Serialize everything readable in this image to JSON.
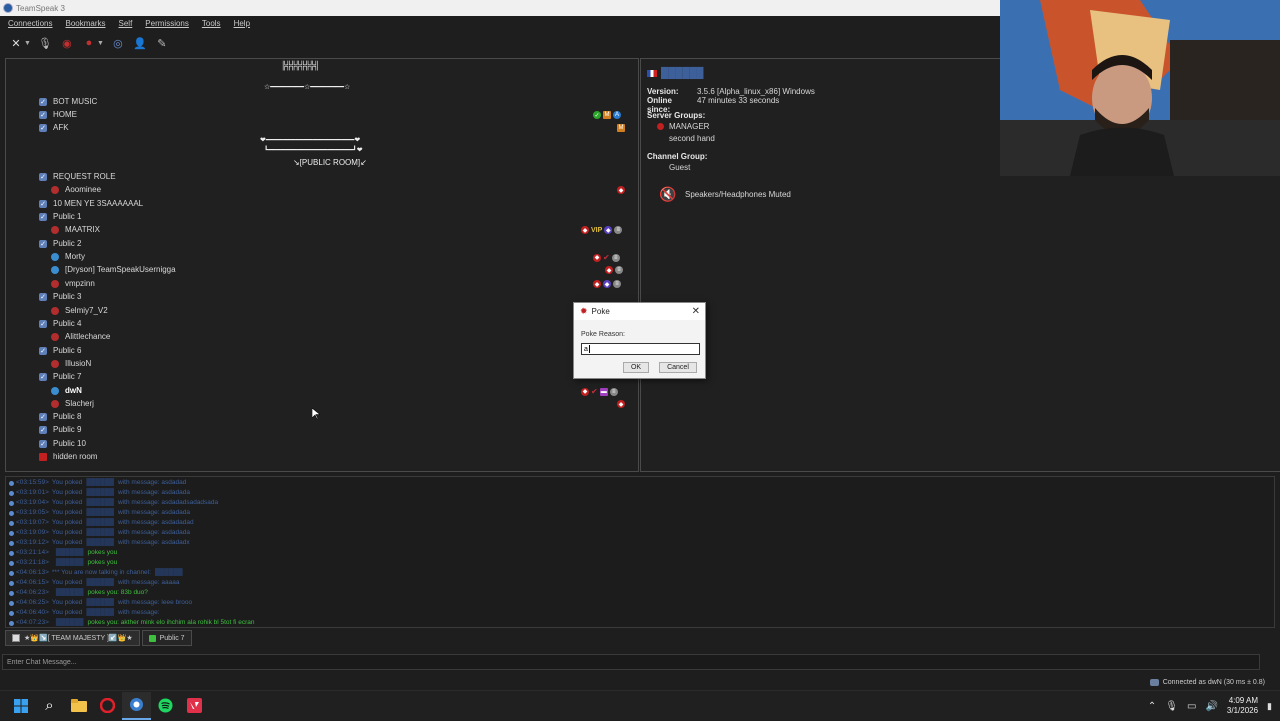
{
  "window": {
    "title": "TeamSpeak 3"
  },
  "menu": [
    "Connections",
    "Bookmarks",
    "Self",
    "Permissions",
    "Tools",
    "Help"
  ],
  "toolbar": {
    "icons": [
      "disconnect-icon",
      "mic-mute-icon",
      "speaker-mute-icon",
      "away-icon",
      "chat-icon",
      "contacts-icon",
      "whisper-icon"
    ]
  },
  "tree": {
    "banner_line": "╠╬╬╬╬╬╬╣",
    "banner_stars": "☆━━━━━━━━☆━━━━━━━━☆",
    "public_deco": "❤━━━━━━━━━━━━━━━━━━━━━❤",
    "public_deco2": "┗━━━━━━━━━━━━━━━━━━━━┛❤",
    "public_room": "↘[PUBLIC ROOM]↙",
    "channels": [
      {
        "label": "BOT MUSIC",
        "type": "channel"
      },
      {
        "label": "HOME",
        "type": "channel"
      },
      {
        "label": "AFK",
        "type": "channel"
      },
      {
        "label": "REQUEST ROLE",
        "type": "channel"
      },
      {
        "label": "Aoominee",
        "type": "user"
      },
      {
        "label": "10 MEN YE 3SAAAAAAL",
        "type": "channel"
      },
      {
        "label": "Public 1",
        "type": "channel"
      },
      {
        "label": "MAATRIX",
        "type": "user"
      },
      {
        "label": "Public 2",
        "type": "channel"
      },
      {
        "label": "Morty",
        "type": "user"
      },
      {
        "label": "[Dryson] TeamSpeakUsernigga",
        "type": "user"
      },
      {
        "label": "vmpzinn",
        "type": "user"
      },
      {
        "label": "Public 3",
        "type": "channel"
      },
      {
        "label": "Selmiy7_V2",
        "type": "user"
      },
      {
        "label": "Public 4",
        "type": "channel"
      },
      {
        "label": "Alittlechance",
        "type": "user"
      },
      {
        "label": "Public 6",
        "type": "channel"
      },
      {
        "label": "IllusioN",
        "type": "user"
      },
      {
        "label": "Public 7",
        "type": "channel"
      },
      {
        "label": "dwN",
        "type": "user"
      },
      {
        "label": "Slacherj",
        "type": "user"
      },
      {
        "label": "Public 8",
        "type": "channel"
      },
      {
        "label": "Public 9",
        "type": "channel"
      },
      {
        "label": "Public 10",
        "type": "channel"
      },
      {
        "label": "hidden room",
        "type": "channel"
      }
    ],
    "vip_badge": "VIP"
  },
  "info": {
    "client_name": "██████",
    "version_label": "Version:",
    "version_value": "3.5.6 [Alpha_linux_x86] Windows",
    "online_label": "Online since:",
    "online_value": "47 minutes 33 seconds",
    "server_groups_label": "Server Groups:",
    "server_groups": [
      "MANAGER",
      "second hand"
    ],
    "channel_group_label": "Channel Group:",
    "channel_group": "Guest",
    "status_text": "Speakers/Headphones Muted"
  },
  "chat": {
    "lines": [
      {
        "ts": "<03:15:59>",
        "pre": "You poked",
        "name": "██████",
        "post": "with message: asdadad",
        "kind": "blue"
      },
      {
        "ts": "<03:19:01>",
        "pre": "You poked",
        "name": "██████",
        "post": "with message: asdadada",
        "kind": "blue"
      },
      {
        "ts": "<03:19:04>",
        "pre": "You poked",
        "name": "██████",
        "post": "with message: asdadadsadadsada",
        "kind": "blue"
      },
      {
        "ts": "<03:19:05>",
        "pre": "You poked",
        "name": "██████",
        "post": "with message: asdadada",
        "kind": "blue"
      },
      {
        "ts": "<03:19:07>",
        "pre": "You poked",
        "name": "██████",
        "post": "with message: asdadadad",
        "kind": "blue"
      },
      {
        "ts": "<03:19:09>",
        "pre": "You poked",
        "name": "██████",
        "post": "with message: asdadada",
        "kind": "blue"
      },
      {
        "ts": "<03:19:12>",
        "pre": "You poked",
        "name": "██████",
        "post": "with message: asdadadx",
        "kind": "blue"
      },
      {
        "ts": "<03:21:14>",
        "pre": "",
        "name": "██████",
        "post": "pokes you",
        "kind": "green"
      },
      {
        "ts": "<03:21:18>",
        "pre": "",
        "name": "██████",
        "post": "pokes you",
        "kind": "green"
      },
      {
        "ts": "<04:06:13>",
        "pre": "*** You are now talking in channel:",
        "name": "██████",
        "post": "",
        "kind": "blue"
      },
      {
        "ts": "<04:06:15>",
        "pre": "You poked",
        "name": "██████",
        "post": "with message: aaaaa",
        "kind": "blue"
      },
      {
        "ts": "<04:06:23>",
        "pre": "",
        "name": "██████",
        "post": "pokes you: 83b duo?",
        "kind": "green"
      },
      {
        "ts": "<04:06:25>",
        "pre": "You poked",
        "name": "██████",
        "post": "with message: leee brooo",
        "kind": "blue"
      },
      {
        "ts": "<04:06:40>",
        "pre": "You poked",
        "name": "██████",
        "post": "with message:",
        "kind": "blue"
      },
      {
        "ts": "<04:07:23>",
        "pre": "",
        "name": "██████",
        "post": "pokes you: akther mink elo ihchim ala rohik bl 5tot fi ecran",
        "kind": "green"
      }
    ]
  },
  "tabs": [
    {
      "label": "★👑↘️[ TEAM MAJESTY ]↙️👑★"
    },
    {
      "label": "Public 7"
    }
  ],
  "chat_input": {
    "placeholder": "Enter Chat Message..."
  },
  "status": {
    "connected": "Connected as dwN (30 ms ± 0.8)"
  },
  "dialog": {
    "title": "Poke",
    "reason_label": "Poke Reason:",
    "reason_value": "a",
    "ok": "OK",
    "cancel": "Cancel"
  },
  "taskbar": {
    "apps": [
      "windows-start-icon",
      "search-icon",
      "file-explorer-icon",
      "opera-icon",
      "teamspeak-icon",
      "spotify-icon",
      "valorant-icon"
    ],
    "time": "4:09 AM",
    "date": "3/1/2026"
  }
}
